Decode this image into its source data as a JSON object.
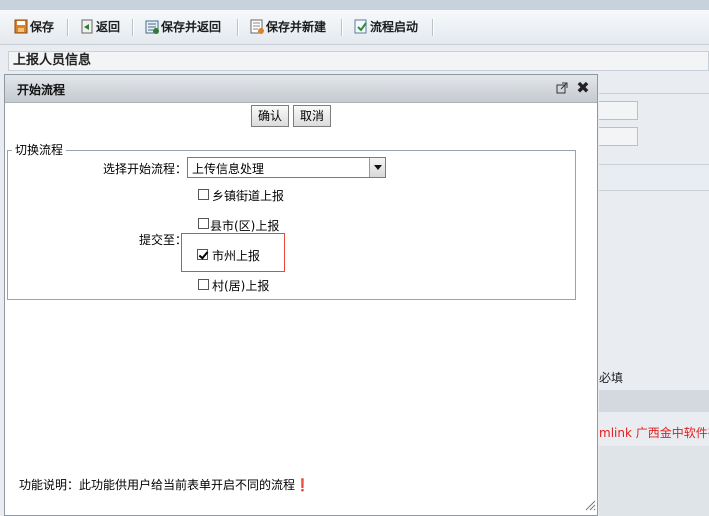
{
  "toolbar": {
    "save_label": "保存",
    "back_label": "返回",
    "save_back_label": "保存并返回",
    "save_new_label": "保存并新建",
    "start_flow_label": "流程启动"
  },
  "background": {
    "section_title": "上报人员信息",
    "required_note": "必填",
    "copyright_fragment": "mlink 广西金中软件有"
  },
  "dialog": {
    "title": "开始流程",
    "confirm_label": "确认",
    "cancel_label": "取消",
    "fieldset_legend": "切换流程",
    "select_label": "选择开始流程：",
    "select_value": "上传信息处理",
    "submit_to_label": "提交至：",
    "options": [
      {
        "label": "乡镇街道上报",
        "checked": false
      },
      {
        "label": "县市(区)上报",
        "checked": false
      },
      {
        "label": "市州上报",
        "checked": true
      },
      {
        "label": "村(居)上报",
        "checked": false
      }
    ],
    "footnote": "功能说明：此功能供用户给当前表单开启不同的流程❗"
  },
  "icons": {
    "save": "save-icon",
    "back": "back-icon",
    "save_back": "save-back-icon",
    "save_new": "save-new-icon",
    "start_flow": "start-flow-icon",
    "popout": "popout-icon",
    "close": "close-icon"
  }
}
